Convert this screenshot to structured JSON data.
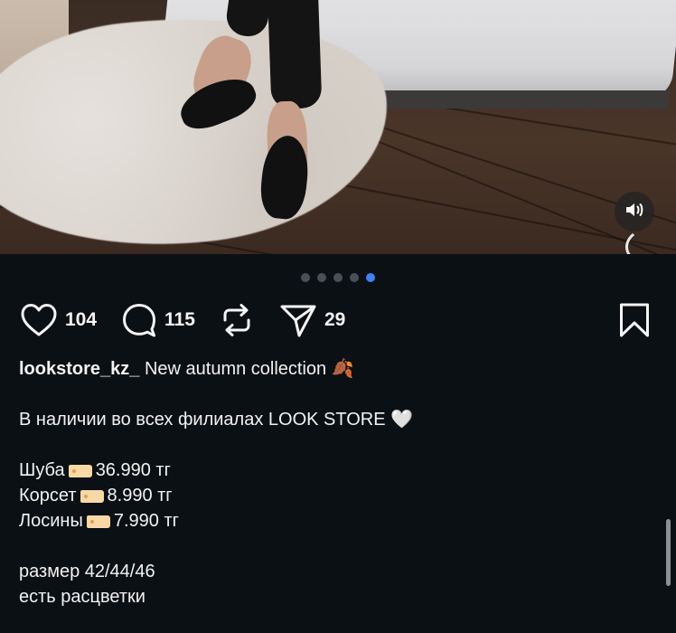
{
  "post": {
    "dots_count": 5,
    "active_dot_index": 4,
    "likes": "104",
    "comments": "115",
    "shares": "29",
    "caption": {
      "username": "lookstore_kz_",
      "title": "New autumn collection",
      "title_emoji": "🍂",
      "availability": "В наличии во всех филиалах LOOK STORE",
      "availability_emoji": "🤍",
      "items": [
        {
          "name": "Шуба",
          "price": "36.990 тг"
        },
        {
          "name": "Корсет",
          "price": "8.990 тг"
        },
        {
          "name": "Лосины",
          "price": "7.990 тг"
        }
      ],
      "sizes": "размер 42/44/46",
      "colors_note": "есть расцветки"
    }
  },
  "colors": {
    "background": "#0b1014",
    "active_dot": "#3b82f6",
    "inactive_dot": "#4a4f56",
    "text": "#f5f5f5"
  },
  "icons": {
    "like": "heart-outline-icon",
    "comment": "speech-bubble-icon",
    "repost": "repost-arrows-icon",
    "share": "send-paper-plane-icon",
    "save": "bookmark-outline-icon",
    "sound": "speaker-icon"
  }
}
